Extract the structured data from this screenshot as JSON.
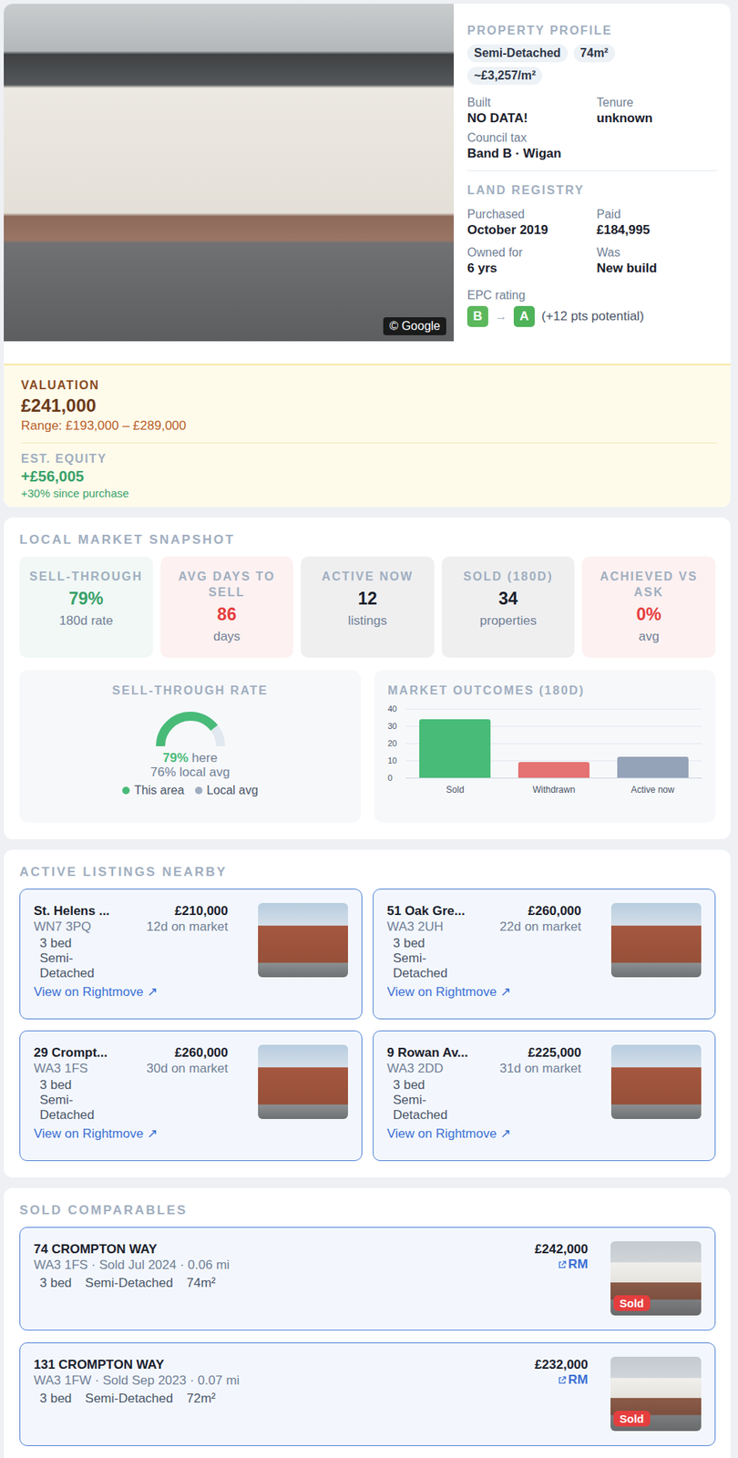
{
  "property": {
    "photo_credit": "© Google",
    "title": "PROPERTY PROFILE",
    "chips": [
      "Semi-Detached",
      "74m²",
      "~£3,257/m²"
    ],
    "facts": [
      {
        "label": "Built",
        "value": "NO DATA!"
      },
      {
        "label": "Tenure",
        "value": "unknown"
      },
      {
        "label": "Council tax",
        "value": "Band B · Wigan"
      }
    ],
    "land_registry": {
      "title": "LAND REGISTRY",
      "facts": [
        {
          "label": "Purchased",
          "value": "October 2019"
        },
        {
          "label": "Paid",
          "value": "£184,995"
        },
        {
          "label": "Owned for",
          "value": "6 yrs"
        },
        {
          "label": "Was",
          "value": "New build"
        }
      ]
    },
    "epc": {
      "label": "EPC rating",
      "arrow": "→",
      "ratings": [
        {
          "band": "B",
          "color": "#5cb85c"
        },
        {
          "band": "A",
          "color": "#4fb35a"
        }
      ],
      "note": "(+12 pts potential)"
    }
  },
  "valuation": {
    "label": "VALUATION",
    "value": "£241,000",
    "range": "Range: £193,000 – £289,000",
    "equity_label": "EST. EQUITY",
    "equity": "+£56,005",
    "equity_note": "+30% since purchase"
  },
  "market": {
    "title": "LOCAL MARKET SNAPSHOT",
    "stats": [
      {
        "label": "SELL-THROUGH",
        "value": "79%",
        "sub": "180d rate",
        "color": "#38a169"
      },
      {
        "label": "AVG DAYS TO SELL",
        "value": "86",
        "sub": "days",
        "color": "#e53e3e"
      },
      {
        "label": "ACTIVE NOW",
        "value": "12",
        "sub": "listings",
        "color": "#1a202c"
      },
      {
        "label": "SOLD (180D)",
        "value": "34",
        "sub": "properties",
        "color": "#1a202c"
      },
      {
        "label": "ACHIEVED VS ASK",
        "value": "0%",
        "sub": "avg",
        "color": "#e53e3e"
      }
    ],
    "gauge": {
      "title": "SELL-THROUGH RATE",
      "level": 0.79,
      "value": "79%",
      "value_suffix": "here",
      "local": "76% local avg",
      "legend": [
        {
          "label": "This area",
          "color": "#48bb78"
        },
        {
          "label": "Local avg",
          "color": "#a0aec0"
        }
      ]
    },
    "outcomes": {
      "title": "MARKET OUTCOMES (180D)",
      "ticks": [
        "40",
        "30",
        "20",
        "10",
        "0"
      ],
      "bars": [
        {
          "label": "Sold",
          "value": 34,
          "color": "#48bb78"
        },
        {
          "label": "Withdrawn",
          "value": 9,
          "color": "#e57373"
        },
        {
          "label": "Active now",
          "value": 12,
          "color": "#94a3b8"
        }
      ]
    }
  },
  "listings": {
    "title": "ACTIVE LISTINGS NEARBY",
    "items": [
      {
        "name": "St. Helens ...",
        "postcode": "WN7 3PQ",
        "price": "£210,000",
        "days": "12d on market",
        "beds": "3 bed",
        "type": "Semi-Detached",
        "link": "View on Rightmove ↗"
      },
      {
        "name": "51 Oak Gre...",
        "postcode": "WA3 2UH",
        "price": "£260,000",
        "days": "22d on market",
        "beds": "3 bed",
        "type": "Semi-Detached",
        "link": "View on Rightmove ↗"
      },
      {
        "name": "29 Crompt...",
        "postcode": "WA3 1FS",
        "price": "£260,000",
        "days": "30d on market",
        "beds": "3 bed",
        "type": "Semi-Detached",
        "link": "View on Rightmove ↗"
      },
      {
        "name": "9 Rowan Av...",
        "postcode": "WA3 2DD",
        "price": "£225,000",
        "days": "31d on market",
        "beds": "3 bed",
        "type": "Semi-Detached",
        "link": "View on Rightmove ↗"
      }
    ]
  },
  "sold": {
    "title": "SOLD COMPARABLES",
    "items": [
      {
        "address": "74 CROMPTON WAY",
        "details": "WA3 1FS · Sold Jul 2024 · 0.06 mi",
        "beds": "3 bed",
        "type": "Semi-Detached",
        "area": "74m²",
        "price": "£242,000",
        "link": "RM",
        "badge": "Sold"
      },
      {
        "address": "131 CROMPTON WAY",
        "details": "WA3 1FW · Sold Sep 2023 · 0.07 mi",
        "beds": "3 bed",
        "type": "Semi-Detached",
        "area": "72m²",
        "price": "£232,000",
        "link": "RM",
        "badge": "Sold"
      }
    ]
  }
}
